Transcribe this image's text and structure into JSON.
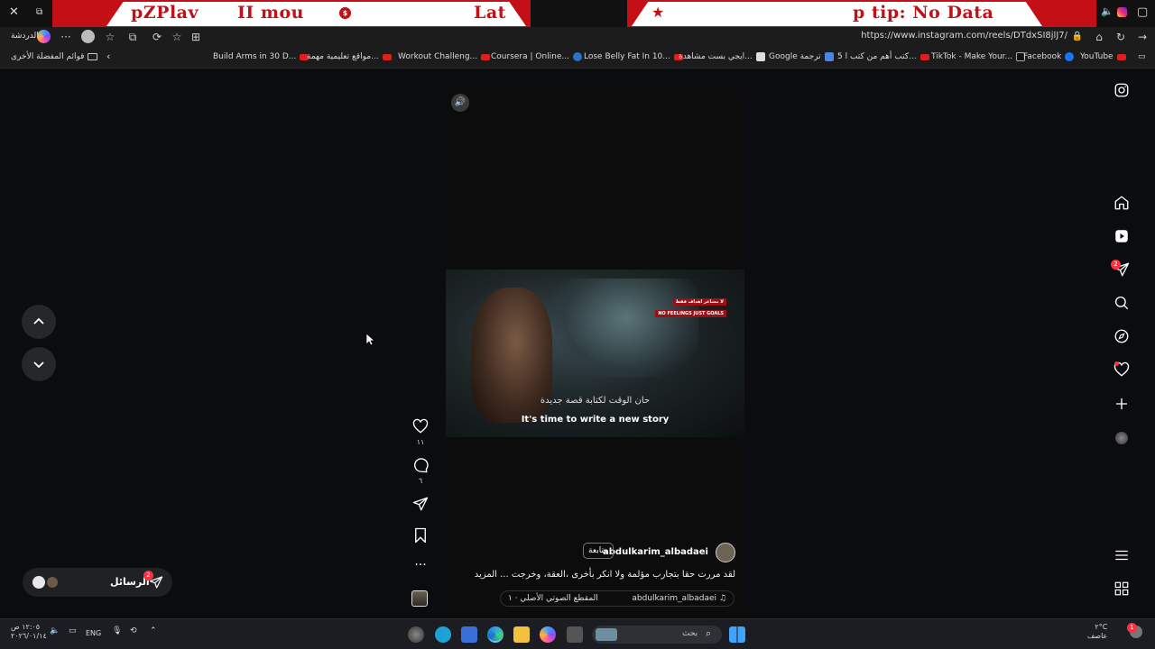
{
  "window": {
    "banner_left": "pZPlav",
    "banner_mid1": "II mou",
    "banner_mid2": "Lat",
    "banner_right": "p tip: No Data",
    "close_label": "✕"
  },
  "toolbar": {
    "profile_label": "الدردشة",
    "url": "https://www.instagram.com/reels/DTdxSI8jlJ7/"
  },
  "bookmarks": {
    "folder_label": "قوائم المفضلة الأخرى",
    "items": [
      {
        "label": "Build Arms in 30 D...",
        "icon": "youtube-icon"
      },
      {
        "label": "مواقع تعليمية مهمة...",
        "icon": "youtube-icon"
      },
      {
        "label": "Workout Challeng...",
        "icon": "youtube-icon"
      },
      {
        "label": "Coursera | Online...",
        "icon": "coursera-icon"
      },
      {
        "label": "Lose Belly Fat In 10...",
        "icon": "youtube-icon"
      },
      {
        "label": "ايجي بست مشاهدة...",
        "icon": "page-icon"
      },
      {
        "label": "Google ترجمة",
        "icon": "translate-icon"
      },
      {
        "label": "5 كتب أهم من كتب ا...",
        "icon": "youtube-icon"
      },
      {
        "label": "TikTok - Make Your...",
        "icon": "tiktok-icon"
      },
      {
        "label": "Facebook",
        "icon": "facebook-icon"
      },
      {
        "label": "YouTube",
        "icon": "youtube-icon"
      }
    ]
  },
  "reel": {
    "video_tag_ar": "لا مشاعر اهداف فقط",
    "video_tag_en": "NO FEELINGS JUST GOALS",
    "subtitle_ar": "حان الوقت لكتابة قصة جديدة",
    "subtitle_en": "It's time to write a new story",
    "username": "abdulkarim_albadaei",
    "follow_label": "متابعة",
    "caption": "لقد مررت حقا بتجارب مؤلمة ولا انكر بأخرى ،العقة، وخرجت ... المزيد",
    "audio_user": "abdulkarim_albadaei",
    "audio_original": "المقطع الصوتي الأصلي · ١"
  },
  "actions": {
    "likes": "١١",
    "comments": "٦"
  },
  "sidebar": {
    "notifications_badge": "2"
  },
  "messages": {
    "label": "الرسائل",
    "badge": "2"
  },
  "taskbar": {
    "time": "١٢:٠٥ ص",
    "date": "٢٠٢٦/٠١/١٤",
    "lang": "ENG",
    "search_placeholder": "بحث",
    "weather_temp": "٢°C",
    "weather_desc": "عاصف",
    "notif_count": "1"
  }
}
